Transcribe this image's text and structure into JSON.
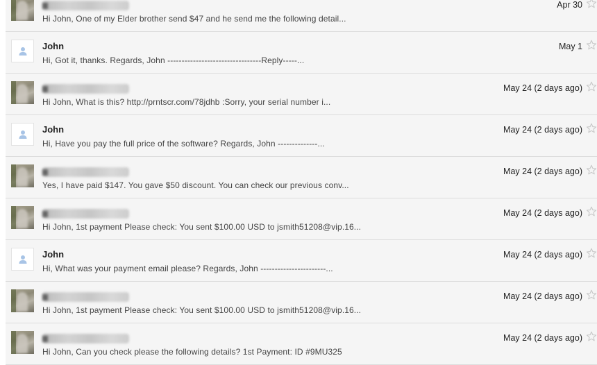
{
  "threads": [
    {
      "sender": "",
      "sender_blurred": true,
      "avatar": "photo",
      "snippet": "Hi John, One of my Elder brother send $47 and he send me the following detail...",
      "date": "Apr 30",
      "starred": false
    },
    {
      "sender": "John",
      "sender_blurred": false,
      "avatar": "default-person-icon",
      "snippet": "Hi, Got it, thanks. Regards, John ---------------------------------Reply-----...",
      "date": "May 1",
      "starred": false
    },
    {
      "sender": "",
      "sender_blurred": true,
      "avatar": "photo",
      "snippet": "Hi John, What is this? http://prntscr.com/78jdhb :Sorry, your serial number i...",
      "date": "May 24 (2 days ago)",
      "starred": false
    },
    {
      "sender": "John",
      "sender_blurred": false,
      "avatar": "default-person-icon",
      "snippet": "Hi, Have you pay the full price of the software? Regards, John --------------...",
      "date": "May 24 (2 days ago)",
      "starred": false
    },
    {
      "sender": "",
      "sender_blurred": true,
      "avatar": "photo",
      "snippet": "Yes, I have paid $147. You gave $50 discount. You can check our previous conv...",
      "date": "May 24 (2 days ago)",
      "starred": false
    },
    {
      "sender": "",
      "sender_blurred": true,
      "avatar": "photo",
      "snippet": "Hi John, 1st payment Please check: You sent $100.00 USD to jsmith51208@vip.16...",
      "date": "May 24 (2 days ago)",
      "starred": false
    },
    {
      "sender": "John",
      "sender_blurred": false,
      "avatar": "default-person-icon",
      "snippet": "Hi, What was your payment email please? Regards, John -----------------------...",
      "date": "May 24 (2 days ago)",
      "starred": false
    },
    {
      "sender": "",
      "sender_blurred": true,
      "avatar": "photo",
      "snippet": "Hi John, 1st payment Please check: You sent $100.00 USD to jsmith51208@vip.16...",
      "date": "May 24 (2 days ago)",
      "starred": false
    },
    {
      "sender": "",
      "sender_blurred": true,
      "avatar": "photo",
      "snippet": "Hi John, Can you check please the following details? 1st Payment: ID #9MU325",
      "date": "May 24 (2 days ago)",
      "starred": false
    }
  ],
  "colors": {
    "row_background": "#f5f5f5",
    "row_border": "#dcdcdc",
    "sender_text": "#222222",
    "snippet_text": "#444444",
    "star_outline": "#c8c8c8",
    "default_avatar_icon": "#a8c4e6"
  }
}
